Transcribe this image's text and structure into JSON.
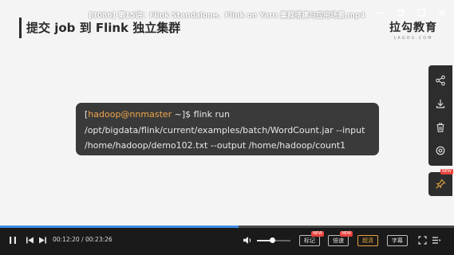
{
  "window": {
    "title": "[3086] 第15讲：Flink Standalone、Flink on Yarn 集群搭建与应用场景.mp4",
    "controls": [
      "minimize-icon",
      "restore-icon",
      "maximize-icon",
      "close-icon"
    ]
  },
  "slide": {
    "title": "提交 job 到 Flink 独立集群",
    "logo": {
      "main": "拉勾教育",
      "sub": "LAGOU.COM"
    },
    "terminal": {
      "prompt_open": "[",
      "user": "hadoop@nnmaster",
      "prompt_rest": " ~]$ flink run",
      "line2": "/opt/bigdata/flink/current/examples/batch/WordCount.jar  --input",
      "line3": "/home/hadoop/demo102.txt  --output  /home/hadoop/count1"
    }
  },
  "side_panel": {
    "buttons": [
      "share-icon",
      "download-icon",
      "delete-icon",
      "settings-icon"
    ],
    "pin": {
      "icon": "pin-icon",
      "badge": "NEW"
    }
  },
  "player": {
    "current_time": "00:12:20",
    "total_time": "00:23:26",
    "time_separator": " / ",
    "progress": 0.526,
    "volume": 0.45,
    "accent": "#3d8be0",
    "pills": [
      {
        "label": "标记",
        "badge": "NEW",
        "active": false
      },
      {
        "label": "倍速",
        "badge": "NEW",
        "active": false
      },
      {
        "label": "超清",
        "badge": "",
        "active": true
      },
      {
        "label": "字幕",
        "badge": "",
        "active": false
      }
    ]
  }
}
